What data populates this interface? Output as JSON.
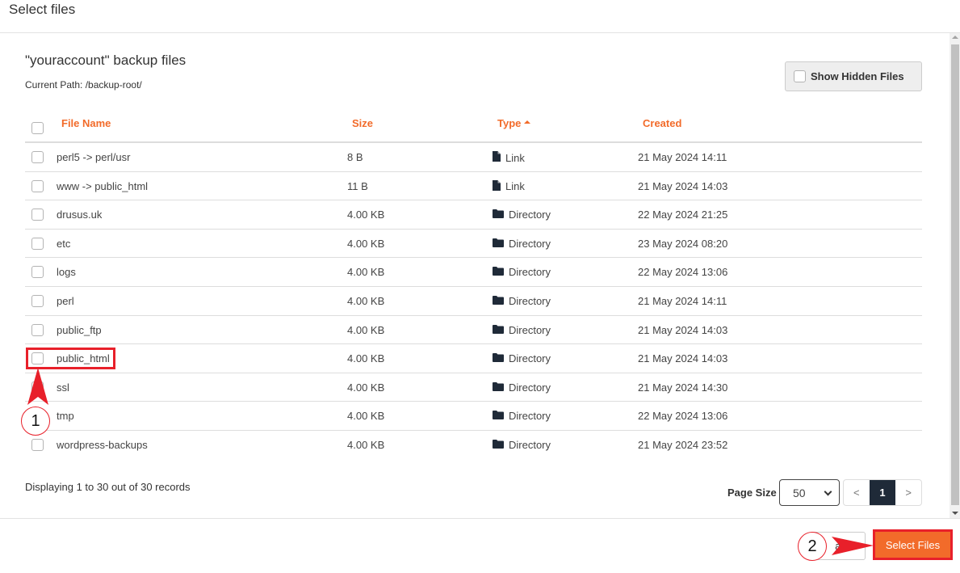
{
  "modal": {
    "title": "Select files"
  },
  "header": {
    "title": "\"youraccount\" backup files",
    "current_path": "Current Path: /backup-root/",
    "show_hidden_label": "Show Hidden Files"
  },
  "table": {
    "columns": {
      "name": "File Name",
      "size": "Size",
      "type": "Type",
      "created": "Created"
    },
    "sort": {
      "column": "type",
      "direction": "asc"
    },
    "rows": [
      {
        "name": "perl5 -> perl/usr",
        "size": "8 B",
        "type": "Link",
        "icon": "file-icon",
        "created": "21 May 2024 14:11"
      },
      {
        "name": "www -> public_html",
        "size": "11 B",
        "type": "Link",
        "icon": "file-icon",
        "created": "21 May 2024 14:03"
      },
      {
        "name": "drusus.uk",
        "size": "4.00 KB",
        "type": "Directory",
        "icon": "folder-icon",
        "created": "22 May 2024 21:25"
      },
      {
        "name": "etc",
        "size": "4.00 KB",
        "type": "Directory",
        "icon": "folder-icon",
        "created": "23 May 2024 08:20"
      },
      {
        "name": "logs",
        "size": "4.00 KB",
        "type": "Directory",
        "icon": "folder-icon",
        "created": "22 May 2024 13:06"
      },
      {
        "name": "perl",
        "size": "4.00 KB",
        "type": "Directory",
        "icon": "folder-icon",
        "created": "21 May 2024 14:11"
      },
      {
        "name": "public_ftp",
        "size": "4.00 KB",
        "type": "Directory",
        "icon": "folder-icon",
        "created": "21 May 2024 14:03"
      },
      {
        "name": "public_html",
        "size": "4.00 KB",
        "type": "Directory",
        "icon": "folder-icon",
        "created": "21 May 2024 14:03"
      },
      {
        "name": "ssl",
        "size": "4.00 KB",
        "type": "Directory",
        "icon": "folder-icon",
        "created": "21 May 2024 14:30"
      },
      {
        "name": "tmp",
        "size": "4.00 KB",
        "type": "Directory",
        "icon": "folder-icon",
        "created": "22 May 2024 13:06"
      },
      {
        "name": "wordpress-backups",
        "size": "4.00 KB",
        "type": "Directory",
        "icon": "folder-icon",
        "created": "21 May 2024 23:52"
      }
    ]
  },
  "pagination": {
    "records_text": "Displaying 1 to 30 out of 30 records",
    "page_size_label": "Page Size",
    "page_size_value": "50",
    "prev_label": "<",
    "current_page": "1",
    "next_label": ">"
  },
  "footer": {
    "cancel_label": "Cancel",
    "cancel_visible_label": "an",
    "select_label": "Select Files"
  },
  "annotations": {
    "step1": "1",
    "step2": "2",
    "color": "#e8202a"
  },
  "colors": {
    "accent": "#f26b2a",
    "pager_active": "#1f2a38",
    "icon": "#1f2a38"
  }
}
